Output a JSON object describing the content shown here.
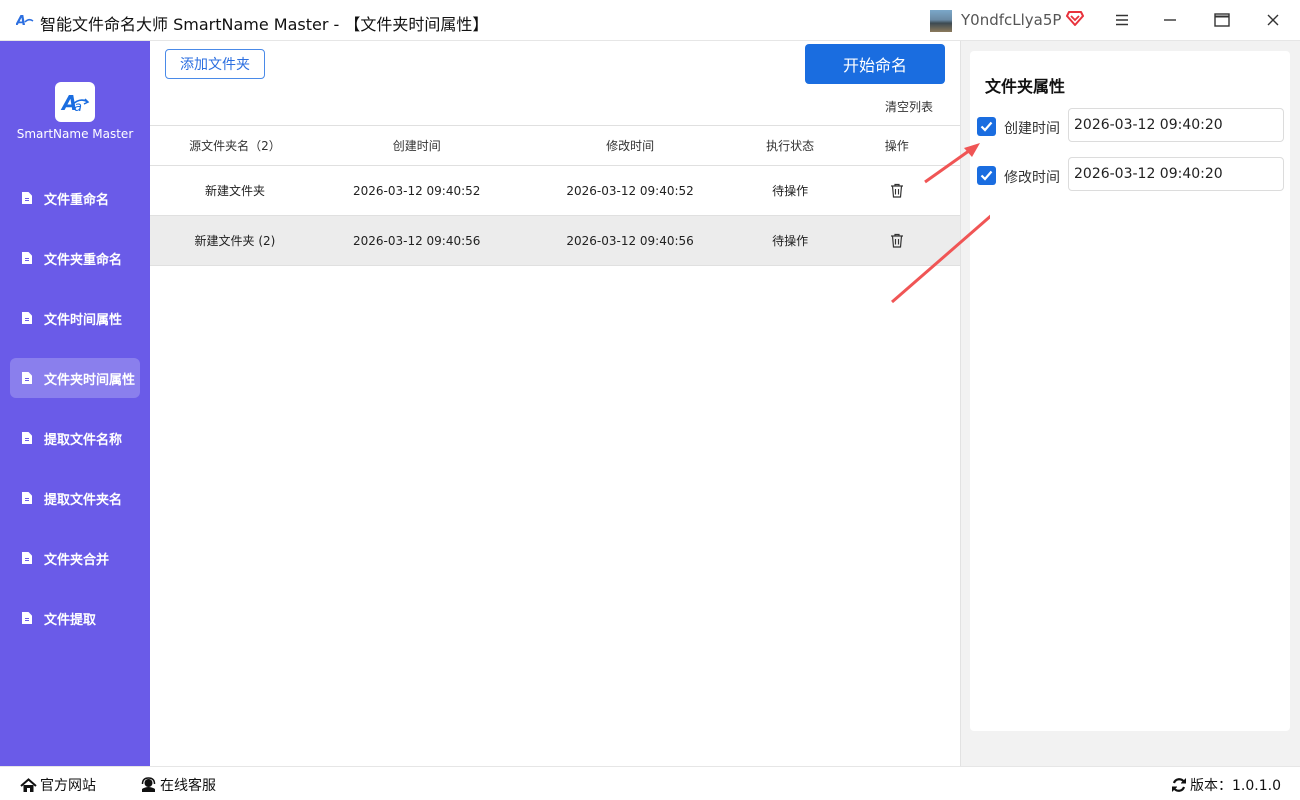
{
  "window": {
    "title": "智能文件命名大师 SmartName Master - 【文件夹时间属性】",
    "username": "Y0ndfcLlya5P",
    "icons": [
      "menu-icon",
      "minimize-icon",
      "maximize-icon",
      "close-icon"
    ]
  },
  "sidebar": {
    "app_name": "SmartName Master",
    "items": [
      {
        "label": "文件重命名"
      },
      {
        "label": "文件夹重命名"
      },
      {
        "label": "文件时间属性"
      },
      {
        "label": "文件夹时间属性",
        "active": true
      },
      {
        "label": "提取文件名称"
      },
      {
        "label": "提取文件夹名"
      },
      {
        "label": "文件夹合并"
      },
      {
        "label": "文件提取"
      }
    ]
  },
  "toolbar": {
    "add_folder_label": "添加文件夹",
    "start_label": "开始命名",
    "clear_list_label": "清空列表"
  },
  "table": {
    "headers": [
      "源文件夹名（2）",
      "创建时间",
      "修改时间",
      "执行状态",
      "操作"
    ],
    "rows": [
      {
        "name": "新建文件夹",
        "created": "2026-03-12 09:40:52",
        "modified": "2026-03-12 09:40:52",
        "status": "待操作"
      },
      {
        "name": "新建文件夹 (2)",
        "created": "2026-03-12 09:40:56",
        "modified": "2026-03-12 09:40:56",
        "status": "待操作"
      }
    ]
  },
  "panel": {
    "title": "文件夹属性",
    "created_label": "创建时间",
    "created_checked": true,
    "created_value": "2026-03-12 09:40:20",
    "modified_label": "修改时间",
    "modified_checked": true,
    "modified_value": "2026-03-12 09:40:20"
  },
  "footer": {
    "website_label": "官方网站",
    "support_label": "在线客服",
    "version_label": "版本：1.0.1.0"
  },
  "colors": {
    "sidebar": "#6a5be8",
    "primary": "#1a6de0",
    "annotation_arrow": "#f05555"
  }
}
